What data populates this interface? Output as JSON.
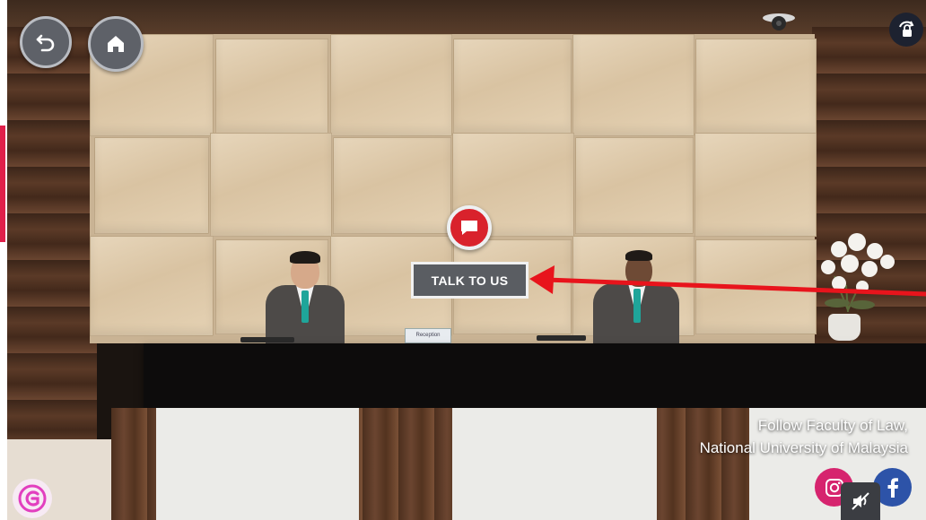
{
  "hotspot": {
    "label": "TALK TO US"
  },
  "desk_sign": "Reception",
  "follow": {
    "line1": "Follow Faculty of Law,",
    "line2": "National University of Malaysia"
  },
  "icons": {
    "back": "back-arrow-icon",
    "home": "home-icon",
    "chat": "chat-icon",
    "rotate_lock": "rotate-lock-icon",
    "instagram": "instagram-icon",
    "facebook": "facebook-icon",
    "mute": "sound-muted-icon",
    "brand": "brand-logo-icon"
  },
  "colors": {
    "hotspot_red": "#d9222c",
    "annotation_arrow": "#e8141c",
    "instagram": "#d6246e",
    "facebook": "#2d53a8",
    "talk_button_bg": "#5a5d62"
  }
}
